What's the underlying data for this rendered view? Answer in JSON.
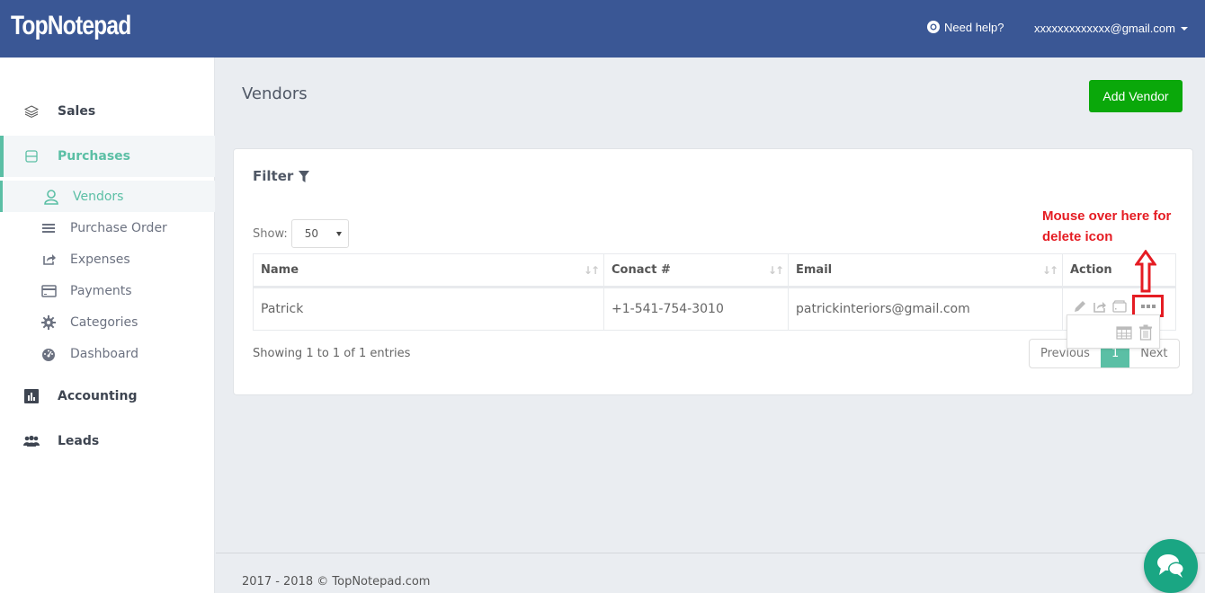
{
  "header": {
    "logo": "TopNotepad",
    "help_label": "Need help?",
    "user_email": "xxxxxxxxxxxxx@gmail.com"
  },
  "sidebar": {
    "items": [
      {
        "label": "Sales",
        "icon": "layers-icon"
      },
      {
        "label": "Purchases",
        "icon": "minus-square-icon",
        "active": true
      },
      {
        "label": "Accounting",
        "icon": "bar-chart-icon"
      },
      {
        "label": "Leads",
        "icon": "users-icon"
      }
    ],
    "sub_items": [
      {
        "label": "Vendors",
        "icon": "user-icon",
        "active": true
      },
      {
        "label": "Purchase Order",
        "icon": "list-icon"
      },
      {
        "label": "Expenses",
        "icon": "share-icon"
      },
      {
        "label": "Payments",
        "icon": "credit-card-icon"
      },
      {
        "label": "Categories",
        "icon": "gear-icon"
      },
      {
        "label": "Dashboard",
        "icon": "dashboard-icon"
      }
    ]
  },
  "main": {
    "title": "Vendors",
    "add_button": "Add Vendor",
    "filter_label": "Filter",
    "show_label": "Show:",
    "page_size": "50",
    "table": {
      "columns": [
        "Name",
        "Conact #",
        "Email",
        "Action"
      ],
      "rows": [
        {
          "name": "Patrick",
          "contact": "+1-541-754-3010",
          "email": "patrickinteriors@gmail.com"
        }
      ]
    },
    "showing_text": "Showing 1 to 1 of 1 entries",
    "pagination": {
      "previous": "Previous",
      "current": "1",
      "next": "Next"
    }
  },
  "annotation": {
    "line1": "Mouse over here for",
    "line2": "delete icon",
    "color": "#e51c23"
  },
  "footer": {
    "text": "2017 - 2018 © TopNotepad.com"
  },
  "colors": {
    "header_bg": "#3a5795",
    "accent": "#5bbfa5",
    "add_button": "#0aa80a",
    "chat_button": "#1aa683"
  }
}
